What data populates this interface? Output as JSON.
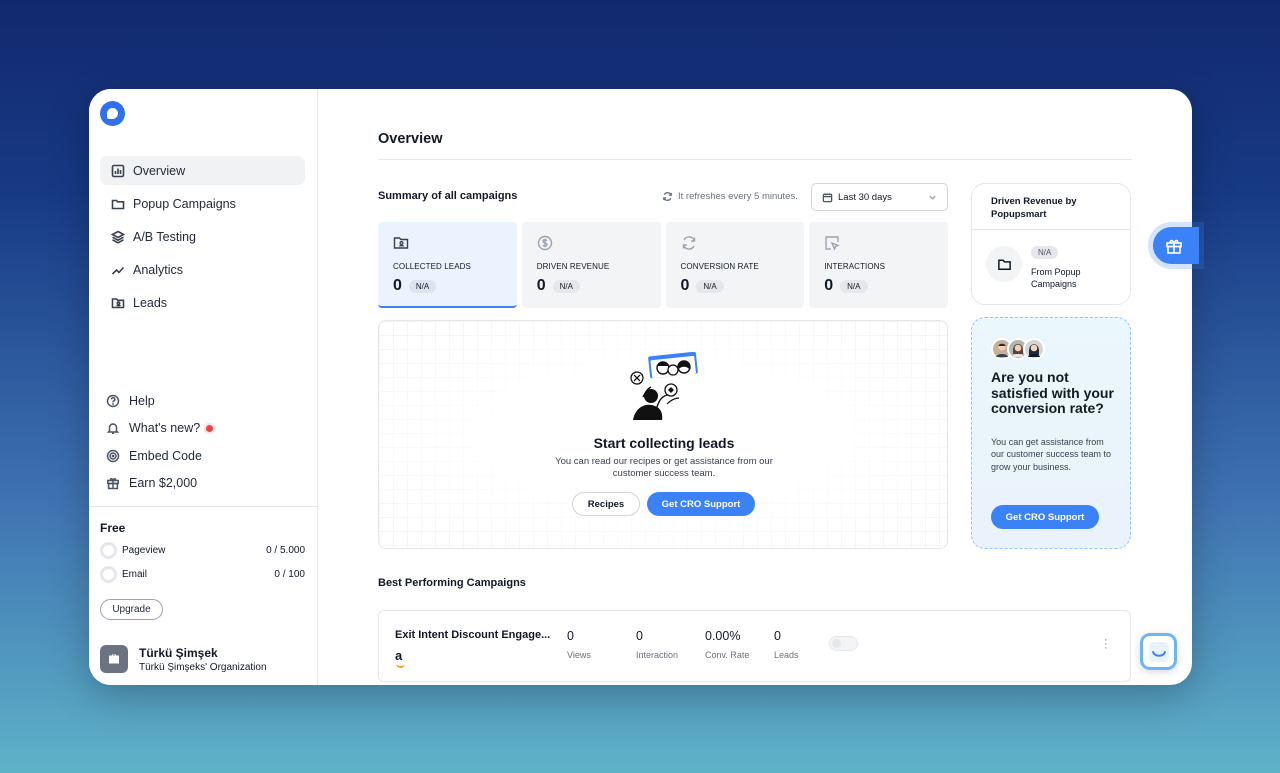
{
  "sidebar": {
    "nav": [
      {
        "label": "Overview",
        "icon": "chart-icon",
        "active": true
      },
      {
        "label": "Popup Campaigns",
        "icon": "folder-icon"
      },
      {
        "label": "A/B Testing",
        "icon": "layers-icon"
      },
      {
        "label": "Analytics",
        "icon": "trend-icon"
      },
      {
        "label": "Leads",
        "icon": "leads-folder-icon"
      }
    ],
    "secondary": [
      {
        "label": "Help",
        "icon": "help-icon"
      },
      {
        "label": "What's new?",
        "icon": "bell-icon"
      },
      {
        "label": "Embed Code",
        "icon": "embed-icon"
      },
      {
        "label": "Earn $2,000",
        "icon": "gift-icon"
      }
    ],
    "plan": {
      "name": "Free",
      "pageview_label": "Pageview",
      "pageview_value": "0 / 5.000",
      "email_label": "Email",
      "email_value": "0 / 100",
      "upgrade_label": "Upgrade"
    },
    "user": {
      "name": "Türkü Şimşek",
      "org": "Türkü Şimşeks' Organization"
    }
  },
  "main": {
    "title": "Overview",
    "summary_title": "Summary of all campaigns",
    "refresh_text": "It refreshes every 5 minutes.",
    "date_range": "Last 30 days",
    "stats": [
      {
        "label": "COLLECTED LEADS",
        "value": "0",
        "badge": "N/A"
      },
      {
        "label": "DRIVEN REVENUE",
        "value": "0",
        "badge": "N/A"
      },
      {
        "label": "CONVERSION RATE",
        "value": "0",
        "badge": "N/A"
      },
      {
        "label": "INTERACTIONS",
        "value": "0",
        "badge": "N/A"
      }
    ],
    "empty_state": {
      "title": "Start collecting leads",
      "description": "You can read our recipes or get assistance from our customer success team.",
      "recipes_label": "Recipes",
      "cro_label": "Get CRO Support"
    },
    "revenue_card": {
      "title": "Driven Revenue by Popupsmart",
      "badge": "N/A",
      "from": "From Popup Campaigns"
    },
    "cro_card": {
      "title": "Are you not satisfied with your conversion rate?",
      "description": "You can get assistance from our customer success team to grow your business.",
      "button": "Get CRO Support"
    },
    "best_title": "Best Performing Campaigns",
    "campaigns": [
      {
        "name": "Exit Intent Discount Engage...",
        "logo": "a",
        "views": "0",
        "views_label": "Views",
        "interaction": "0",
        "interaction_label": "Interaction",
        "conv_rate": "0.00%",
        "conv_rate_label": "Conv. Rate",
        "leads": "0",
        "leads_label": "Leads"
      }
    ]
  },
  "colors": {
    "accent": "#3b82f6",
    "logo": "#2f6ff0"
  }
}
